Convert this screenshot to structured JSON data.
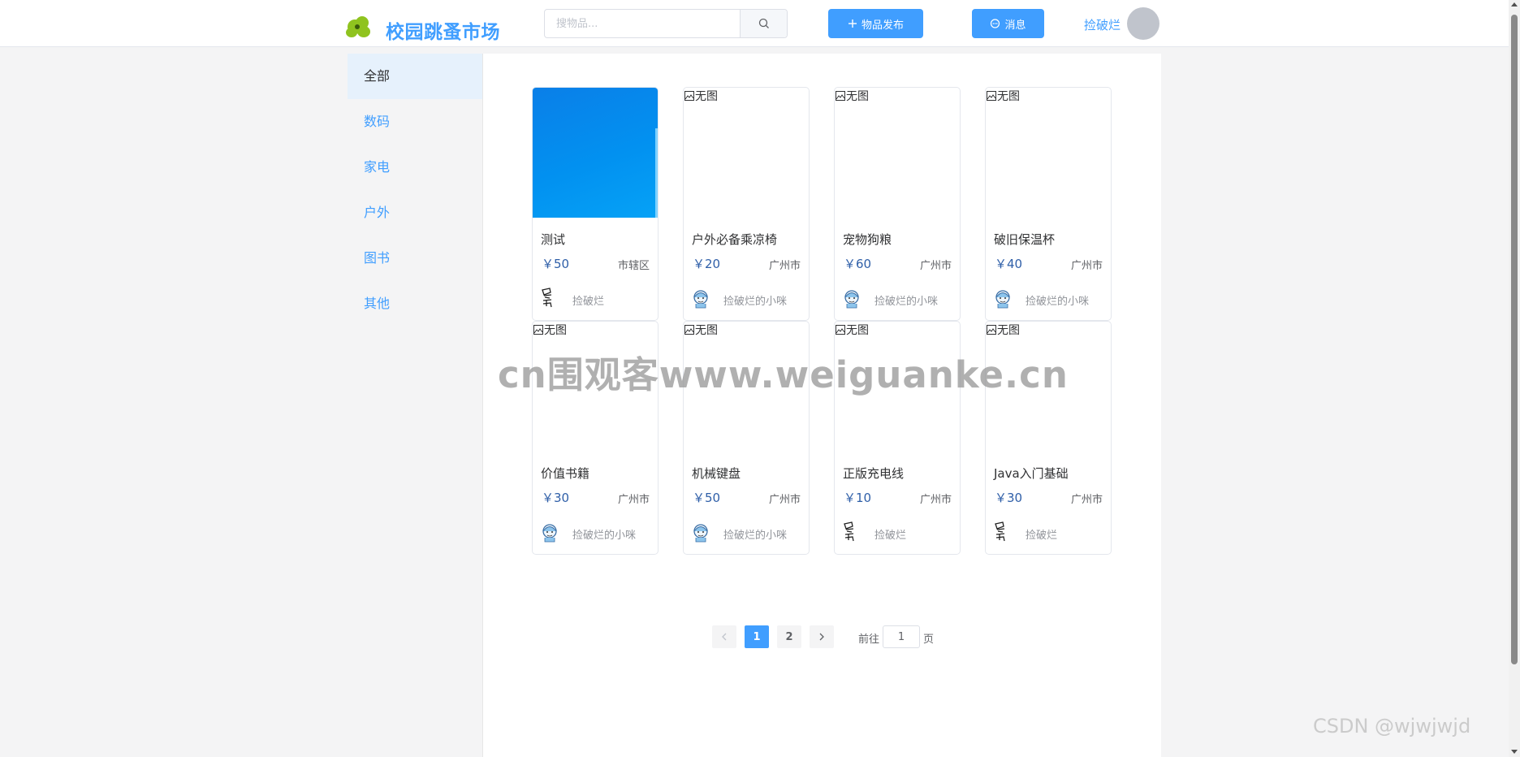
{
  "header": {
    "title": "校园跳蚤市场",
    "search_placeholder": "搜物品...",
    "publish_label": "物品发布",
    "message_label": "消息",
    "username": "捡破烂"
  },
  "sidebar": {
    "items": [
      {
        "label": "全部",
        "active": true
      },
      {
        "label": "数码"
      },
      {
        "label": "家电"
      },
      {
        "label": "户外"
      },
      {
        "label": "图书"
      },
      {
        "label": "其他"
      }
    ]
  },
  "no_image_text": "无图",
  "products": [
    {
      "name": "测试",
      "price": "￥50",
      "location": "市辖区",
      "seller": "捡破烂",
      "has_image": true,
      "avatar": "sketch-avatar-icon"
    },
    {
      "name": "户外必备乘凉椅",
      "price": "￥20",
      "location": "广州市",
      "seller": "捡破烂的小咪",
      "has_image": false,
      "avatar": "girl-avatar-icon"
    },
    {
      "name": "宠物狗粮",
      "price": "￥60",
      "location": "广州市",
      "seller": "捡破烂的小咪",
      "has_image": false,
      "avatar": "girl-avatar-icon"
    },
    {
      "name": "破旧保温杯",
      "price": "￥40",
      "location": "广州市",
      "seller": "捡破烂的小咪",
      "has_image": false,
      "avatar": "girl-avatar-icon"
    },
    {
      "name": "价值书籍",
      "price": "￥30",
      "location": "广州市",
      "seller": "捡破烂的小咪",
      "has_image": false,
      "avatar": "girl-avatar-icon"
    },
    {
      "name": "机械键盘",
      "price": "￥50",
      "location": "广州市",
      "seller": "捡破烂的小咪",
      "has_image": false,
      "avatar": "girl-avatar-icon"
    },
    {
      "name": "正版充电线",
      "price": "￥10",
      "location": "广州市",
      "seller": "捡破烂",
      "has_image": false,
      "avatar": "sketch-avatar-icon"
    },
    {
      "name": "Java入门基础",
      "price": "￥30",
      "location": "广州市",
      "seller": "捡破烂",
      "has_image": false,
      "avatar": "sketch-avatar-icon"
    }
  ],
  "pagination": {
    "pages": [
      "1",
      "2"
    ],
    "current": "1",
    "goto_label": "前往",
    "goto_value": "1",
    "page_suffix": "页"
  },
  "watermarks": {
    "main": "cn围观客www.weiguanke.cn",
    "csdn": "CSDN @wjwjwjd"
  },
  "colors": {
    "primary": "#409eff",
    "price": "#2f5fa8",
    "logo_green": "#8fc31f"
  }
}
